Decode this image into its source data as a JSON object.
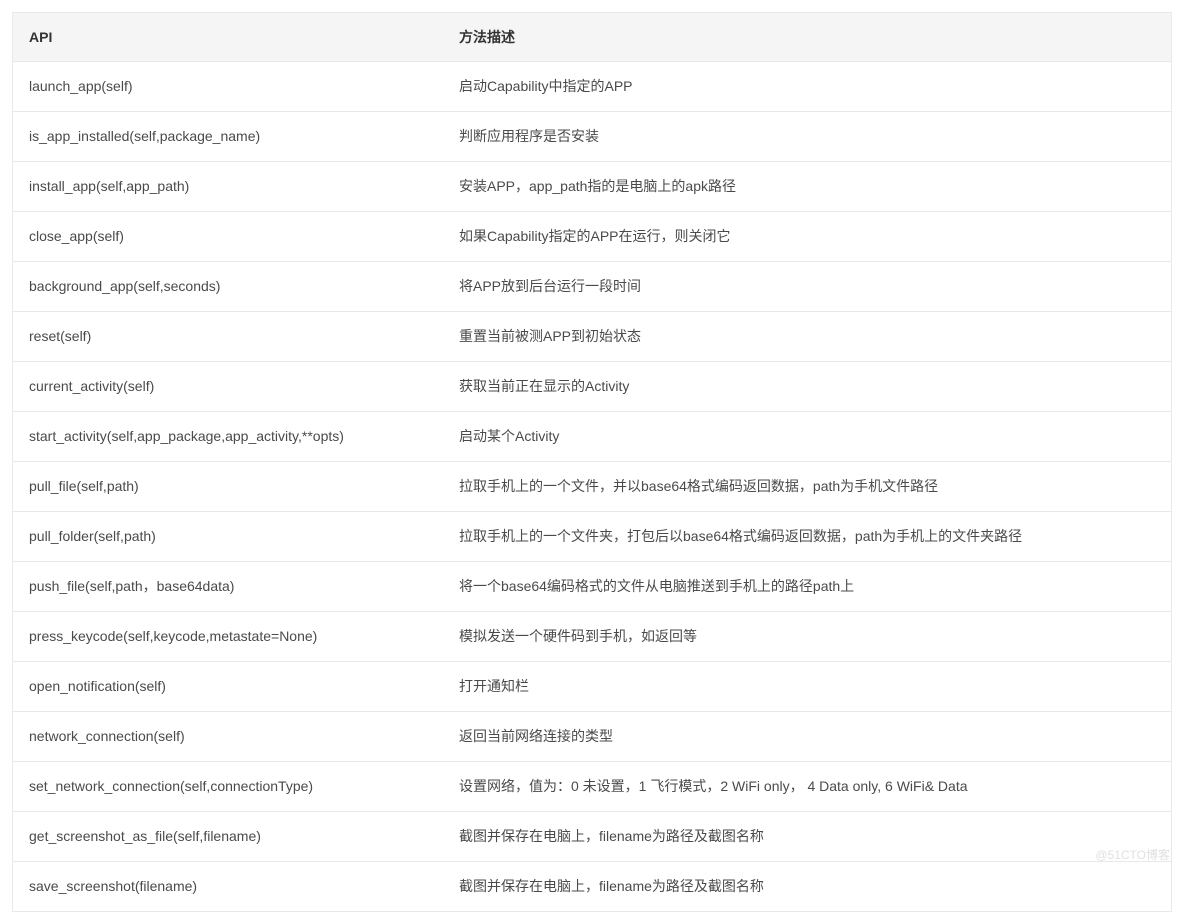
{
  "table": {
    "headers": {
      "api": "API",
      "desc": "方法描述"
    },
    "rows": [
      {
        "api": "launch_app(self)",
        "desc": "启动Capability中指定的APP"
      },
      {
        "api": "is_app_installed(self,package_name)",
        "desc": "判断应用程序是否安装"
      },
      {
        "api": "install_app(self,app_path)",
        "desc": "安装APP，app_path指的是电脑上的apk路径"
      },
      {
        "api": "close_app(self)",
        "desc": "如果Capability指定的APP在运行，则关闭它"
      },
      {
        "api": "background_app(self,seconds)",
        "desc": "将APP放到后台运行一段时间"
      },
      {
        "api": "reset(self)",
        "desc": "重置当前被测APP到初始状态"
      },
      {
        "api": "current_activity(self)",
        "desc": "获取当前正在显示的Activity"
      },
      {
        "api": "start_activity(self,app_package,app_activity,**opts)",
        "desc": "启动某个Activity"
      },
      {
        "api": "pull_file(self,path)",
        "desc": "拉取手机上的一个文件，并以base64格式编码返回数据，path为手机文件路径"
      },
      {
        "api": "pull_folder(self,path)",
        "desc": "拉取手机上的一个文件夹，打包后以base64格式编码返回数据，path为手机上的文件夹路径"
      },
      {
        "api": "push_file(self,path，base64data)",
        "desc": "将一个base64编码格式的文件从电脑推送到手机上的路径path上"
      },
      {
        "api": "press_keycode(self,keycode,metastate=None)",
        "desc": "模拟发送一个硬件码到手机，如返回等"
      },
      {
        "api": "open_notification(self)",
        "desc": "打开通知栏"
      },
      {
        "api": "network_connection(self)",
        "desc": "返回当前网络连接的类型"
      },
      {
        "api": "set_network_connection(self,connectionType)",
        "desc": "设置网络，值为：0 未设置，1 飞行模式，2 WiFi only， 4 Data only, 6 WiFi& Data"
      },
      {
        "api": "get_screenshot_as_file(self,filename)",
        "desc": "截图并保存在电脑上，filename为路径及截图名称"
      },
      {
        "api": "save_screenshot(filename)",
        "desc": "截图并保存在电脑上，filename为路径及截图名称"
      }
    ]
  },
  "watermark": "@51CTO博客"
}
